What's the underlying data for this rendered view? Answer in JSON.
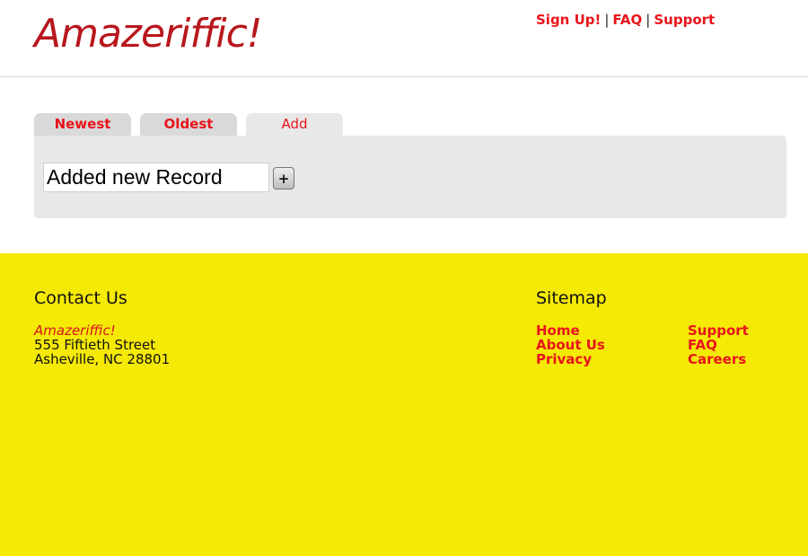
{
  "header": {
    "logo": "Amazeriffic!",
    "nav": {
      "signup": "Sign Up!",
      "faq": "FAQ",
      "support": "Support",
      "separator": "|"
    }
  },
  "tabs": [
    {
      "label": "Newest",
      "active": false
    },
    {
      "label": "Oldest",
      "active": false
    },
    {
      "label": "Add",
      "active": true
    }
  ],
  "add_panel": {
    "input_value": "Added new Record",
    "add_button_label": "+"
  },
  "footer": {
    "contact": {
      "heading": "Contact Us",
      "company": "Amazeriffic!",
      "street": "555 Fiftieth Street",
      "city": "Asheville, NC 28801"
    },
    "sitemap": {
      "heading": "Sitemap",
      "col1": [
        "Home",
        "About Us",
        "Privacy"
      ],
      "col2": [
        "Support",
        "FAQ",
        "Careers"
      ]
    }
  },
  "colors": {
    "accent_red": "#e8141b",
    "logo_red": "#b8171d",
    "footer_yellow": "#f5e906",
    "panel_gray": "#e8e8e8",
    "tab_gray": "#d9d9d9"
  }
}
